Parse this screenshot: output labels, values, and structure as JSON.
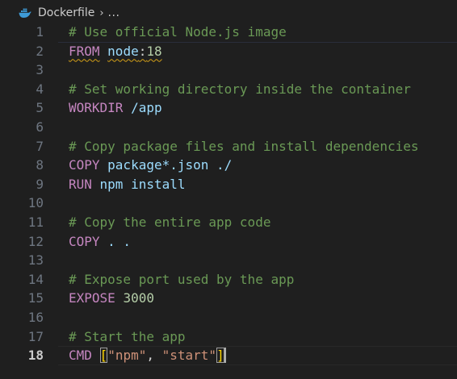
{
  "breadcrumb": {
    "file": "Dockerfile",
    "separator": "›",
    "more": "...",
    "icon": "docker-whale-icon"
  },
  "editor": {
    "active_line": 18,
    "lines": [
      {
        "n": "1",
        "tokens": [
          {
            "t": "# Use official Node.js image",
            "c": "comment"
          }
        ]
      },
      {
        "n": "2",
        "tokens": [
          {
            "t": "FROM",
            "c": "keyword",
            "sq": true
          },
          {
            "t": " ",
            "c": "text"
          },
          {
            "t": "node",
            "c": "plain",
            "sq": true
          },
          {
            "t": ":",
            "c": "op",
            "sq": true
          },
          {
            "t": "18",
            "c": "num",
            "sq": true
          }
        ]
      },
      {
        "n": "3",
        "tokens": []
      },
      {
        "n": "4",
        "tokens": [
          {
            "t": "# Set working directory inside the container",
            "c": "comment"
          }
        ]
      },
      {
        "n": "5",
        "tokens": [
          {
            "t": "WORKDIR",
            "c": "keyword"
          },
          {
            "t": " /app",
            "c": "plain"
          }
        ]
      },
      {
        "n": "6",
        "tokens": []
      },
      {
        "n": "7",
        "tokens": [
          {
            "t": "# Copy package files and install dependencies",
            "c": "comment"
          }
        ]
      },
      {
        "n": "8",
        "tokens": [
          {
            "t": "COPY",
            "c": "keyword"
          },
          {
            "t": " package*.json ./",
            "c": "plain"
          }
        ]
      },
      {
        "n": "9",
        "tokens": [
          {
            "t": "RUN",
            "c": "keyword"
          },
          {
            "t": " npm install",
            "c": "plain"
          }
        ]
      },
      {
        "n": "10",
        "tokens": []
      },
      {
        "n": "11",
        "tokens": [
          {
            "t": "# Copy the entire app code",
            "c": "comment"
          }
        ]
      },
      {
        "n": "12",
        "tokens": [
          {
            "t": "COPY",
            "c": "keyword"
          },
          {
            "t": " . .",
            "c": "plain"
          }
        ]
      },
      {
        "n": "13",
        "tokens": []
      },
      {
        "n": "14",
        "tokens": [
          {
            "t": "# Expose port used by the app",
            "c": "comment"
          }
        ]
      },
      {
        "n": "15",
        "tokens": [
          {
            "t": "EXPOSE",
            "c": "keyword"
          },
          {
            "t": " ",
            "c": "text"
          },
          {
            "t": "3000",
            "c": "num"
          }
        ]
      },
      {
        "n": "16",
        "tokens": []
      },
      {
        "n": "17",
        "tokens": [
          {
            "t": "# Start the app",
            "c": "comment"
          }
        ]
      },
      {
        "n": "18",
        "tokens": [
          {
            "t": "CMD",
            "c": "keyword"
          },
          {
            "t": " ",
            "c": "text"
          },
          {
            "t": "[",
            "c": "bracket"
          },
          {
            "t": "\"npm\"",
            "c": "str"
          },
          {
            "t": ", ",
            "c": "text"
          },
          {
            "t": "\"start\"",
            "c": "str"
          },
          {
            "t": "]",
            "c": "bracket"
          },
          {
            "t": "",
            "c": "cursor"
          }
        ]
      }
    ]
  },
  "colors": {
    "background": "#1f1f1f",
    "comment": "#6a9955",
    "keyword": "#c586c0",
    "plain": "#9cdcfe",
    "number": "#b5cea8",
    "string": "#ce9178",
    "bracket": "#ffd700",
    "line_number": "#6e7681",
    "line_number_active": "#cccccc",
    "warning_squiggle": "#d4a017"
  }
}
